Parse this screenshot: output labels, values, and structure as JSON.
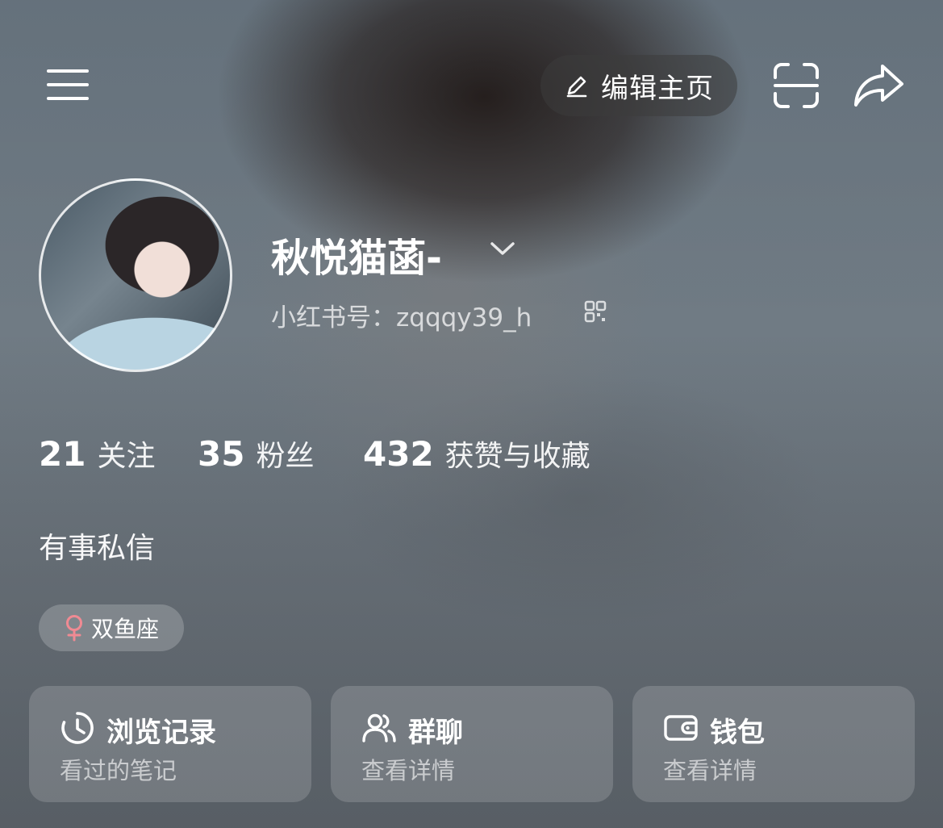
{
  "header": {
    "edit_label": "编辑主页",
    "icons": [
      "menu-icon",
      "pencil-icon",
      "scan-icon",
      "share-icon"
    ]
  },
  "profile": {
    "username": "秋悦猫菡-",
    "redbook_id": "小红书号：zqqqy39_h",
    "bio": "有事私信",
    "tag": {
      "icon": "female-icon",
      "label": "双鱼座",
      "icon_color": "#f08a93"
    }
  },
  "stats": [
    {
      "num": "21",
      "label": "关注"
    },
    {
      "num": "35",
      "label": "粉丝"
    },
    {
      "num": "432",
      "label": "获赞与收藏"
    }
  ],
  "cards": [
    {
      "icon": "history-clock-icon",
      "title": "浏览记录",
      "subtitle": "看过的笔记"
    },
    {
      "icon": "group-icon",
      "title": "群聊",
      "subtitle": "查看详情"
    },
    {
      "icon": "wallet-icon",
      "title": "钱包",
      "subtitle": "查看详情"
    }
  ]
}
